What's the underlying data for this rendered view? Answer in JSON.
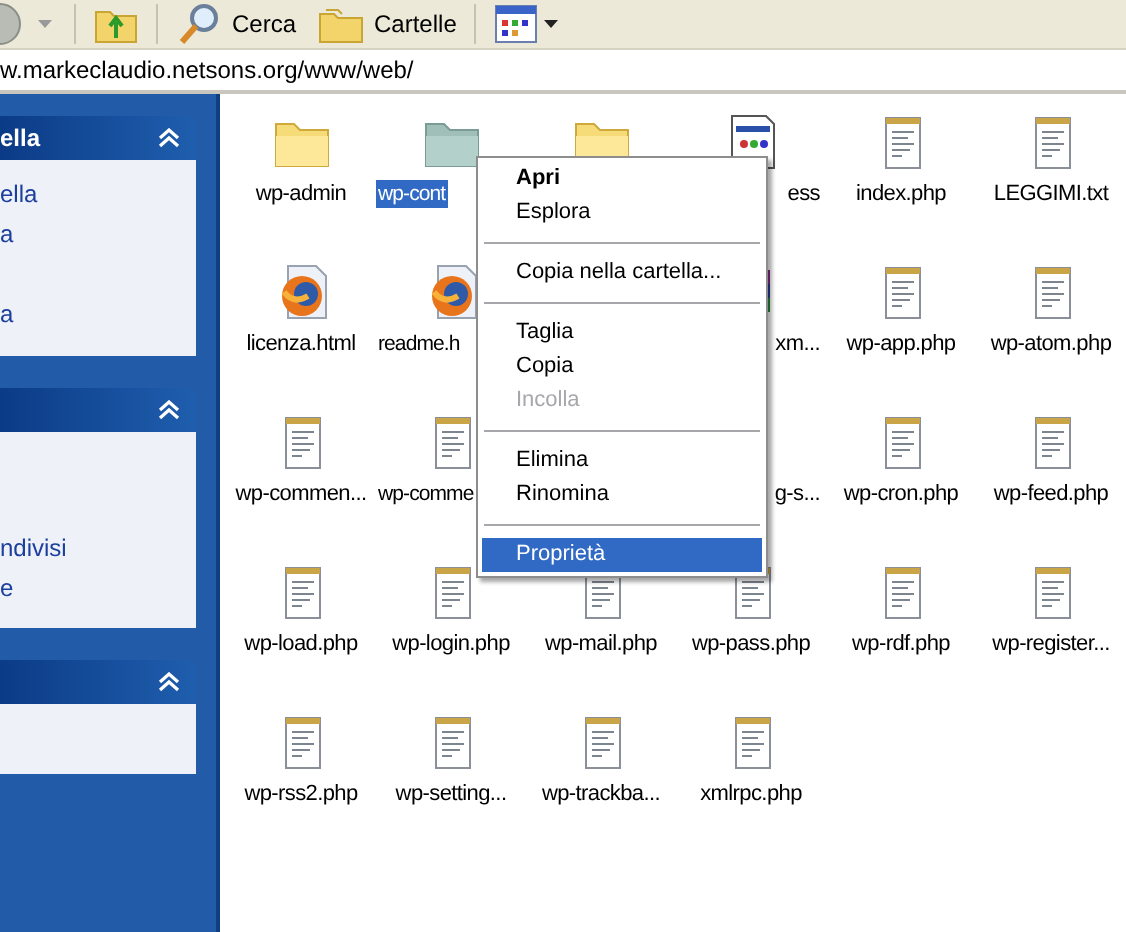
{
  "toolbar": {
    "buttons": [
      {
        "kind": "back"
      },
      {
        "kind": "up"
      },
      {
        "kind": "search",
        "label": "Cerca"
      },
      {
        "kind": "folders",
        "label": "Cartelle"
      },
      {
        "kind": "views"
      }
    ]
  },
  "address": {
    "value": "w.markeclaudio.netsons.org/www/web/"
  },
  "sidebar": {
    "panels": [
      {
        "title": "ella",
        "expanded": true,
        "links": [
          "ella",
          "a",
          "a"
        ]
      },
      {
        "expanded": true,
        "links": [
          "ndivisi",
          "e"
        ]
      },
      {
        "expanded": true
      }
    ]
  },
  "files": [
    {
      "name": "wp-admin",
      "kind": "folder",
      "selected": false
    },
    {
      "name": "wp-cont",
      "kind": "folder",
      "selected": true
    },
    {
      "kind": "folder",
      "selected": false
    },
    {
      "name": "ess",
      "kind": "app",
      "selected": false
    },
    {
      "name": "index.php",
      "kind": "notepad",
      "selected": false
    },
    {
      "name": "LEGGIMI.txt",
      "kind": "notepad",
      "selected": false
    },
    {
      "name": "licenza.html",
      "kind": "firefox",
      "selected": false
    },
    {
      "name": "readme.h",
      "kind": "firefox",
      "selected": false
    },
    {
      "kind": "hidden"
    },
    {
      "name": "xm...",
      "kind": "archive",
      "selected": false
    },
    {
      "name": "wp-app.php",
      "kind": "notepad",
      "selected": false
    },
    {
      "name": "wp-atom.php",
      "kind": "notepad",
      "selected": false
    },
    {
      "name": "wp-commen...",
      "kind": "notepad",
      "selected": false
    },
    {
      "name": "wp-comme",
      "kind": "notepad",
      "selected": false
    },
    {
      "kind": "hidden"
    },
    {
      "name": "g-s...",
      "kind": "hidden",
      "selected": false
    },
    {
      "name": "wp-cron.php",
      "kind": "notepad",
      "selected": false
    },
    {
      "name": "wp-feed.php",
      "kind": "notepad",
      "selected": false
    },
    {
      "name": "wp-load.php",
      "kind": "notepad",
      "selected": false
    },
    {
      "name": "wp-login.php",
      "kind": "notepad",
      "selected": false
    },
    {
      "name": "wp-mail.php",
      "kind": "notepad",
      "selected": false
    },
    {
      "name": "wp-pass.php",
      "kind": "notepad",
      "selected": false
    },
    {
      "name": "wp-rdf.php",
      "kind": "notepad",
      "selected": false
    },
    {
      "name": "wp-register...",
      "kind": "notepad",
      "selected": false
    },
    {
      "name": "wp-rss2.php",
      "kind": "notepad",
      "selected": false
    },
    {
      "name": "wp-setting...",
      "kind": "notepad",
      "selected": false
    },
    {
      "name": "wp-trackba...",
      "kind": "notepad",
      "selected": false
    },
    {
      "name": "xmlrpc.php",
      "kind": "notepad",
      "selected": false
    }
  ],
  "context_menu": {
    "items": [
      {
        "kind": "item",
        "label": "Apri",
        "default": true,
        "disabled": false,
        "selected": false
      },
      {
        "kind": "item",
        "label": "Esplora",
        "default": false,
        "disabled": false,
        "selected": false
      },
      {
        "kind": "separator"
      },
      {
        "kind": "item",
        "label": "Copia nella cartella...",
        "default": false,
        "disabled": false,
        "selected": false
      },
      {
        "kind": "separator"
      },
      {
        "kind": "item",
        "label": "Taglia",
        "default": false,
        "disabled": false,
        "selected": false
      },
      {
        "kind": "item",
        "label": "Copia",
        "default": false,
        "disabled": false,
        "selected": false
      },
      {
        "kind": "item",
        "label": "Incolla",
        "default": false,
        "disabled": true,
        "selected": false
      },
      {
        "kind": "separator"
      },
      {
        "kind": "item",
        "label": "Elimina",
        "default": false,
        "disabled": false,
        "selected": false
      },
      {
        "kind": "item",
        "label": "Rinomina",
        "default": false,
        "disabled": false,
        "selected": false
      },
      {
        "kind": "separator"
      },
      {
        "kind": "item",
        "label": "Proprietà",
        "default": false,
        "disabled": false,
        "selected": true
      }
    ]
  }
}
